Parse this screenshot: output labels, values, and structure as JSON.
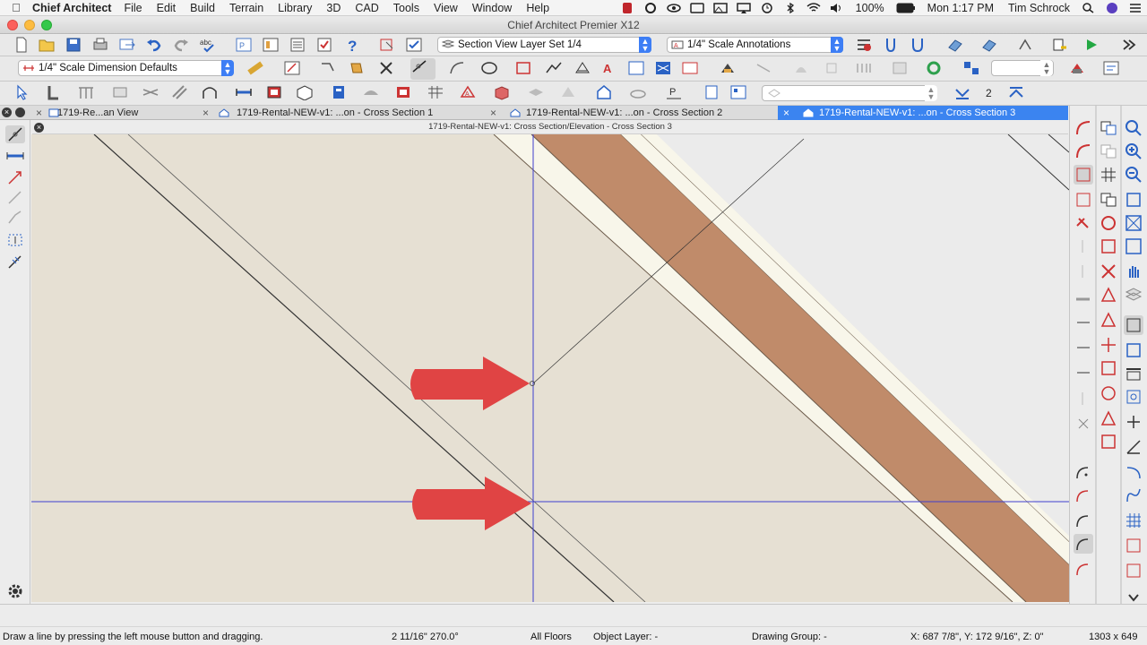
{
  "menubar": {
    "app_name": "Chief Architect",
    "items": [
      "File",
      "Edit",
      "Build",
      "Terrain",
      "Library",
      "3D",
      "CAD",
      "Tools",
      "View",
      "Window",
      "Help"
    ],
    "battery": "100%",
    "clock": "Mon 1:17 PM",
    "user": "Tim Schrock"
  },
  "window": {
    "title": "Chief Architect Premier X12"
  },
  "toolbar1": {
    "layer_set": "Section View Layer Set 1/4",
    "annotation_set": "1/4\" Scale Annotations",
    "spell_label": "abc"
  },
  "toolbar2": {
    "dimension_defaults": "1/4\" Scale Dimension Defaults"
  },
  "toolbar3": {
    "floor_number": "2"
  },
  "tabs": [
    {
      "label": "1719-Re...an View",
      "active": false
    },
    {
      "label": "1719-Rental-NEW-v1: ...on - Cross Section 1",
      "active": false
    },
    {
      "label": "1719-Rental-NEW-v1: ...on - Cross Section 2",
      "active": false
    },
    {
      "label": "1719-Rental-NEW-v1: ...on - Cross Section 3",
      "active": true
    }
  ],
  "view_subtitle": "1719-Rental-NEW-v1: Cross Section/Elevation - Cross Section 3",
  "colors": {
    "canvas": "#e6e0d3",
    "wall_fill": "#c08b6a",
    "wall_trim": "#f8f6ea",
    "guide_line": "#3f3fcf",
    "arrow": "#e04444",
    "accent": "#3b84f0"
  },
  "status": {
    "hint": "Draw a line by pressing the left mouse button and dragging.",
    "length_angle": "2 11/16\"  270.0°",
    "floors": "All Floors",
    "object_layer": "Object Layer: -",
    "drawing_group": "Drawing Group: -",
    "coordinates": "X: 687 7/8\", Y: 172 9/16\", Z: 0\"",
    "window_size": "1303 x 649"
  }
}
